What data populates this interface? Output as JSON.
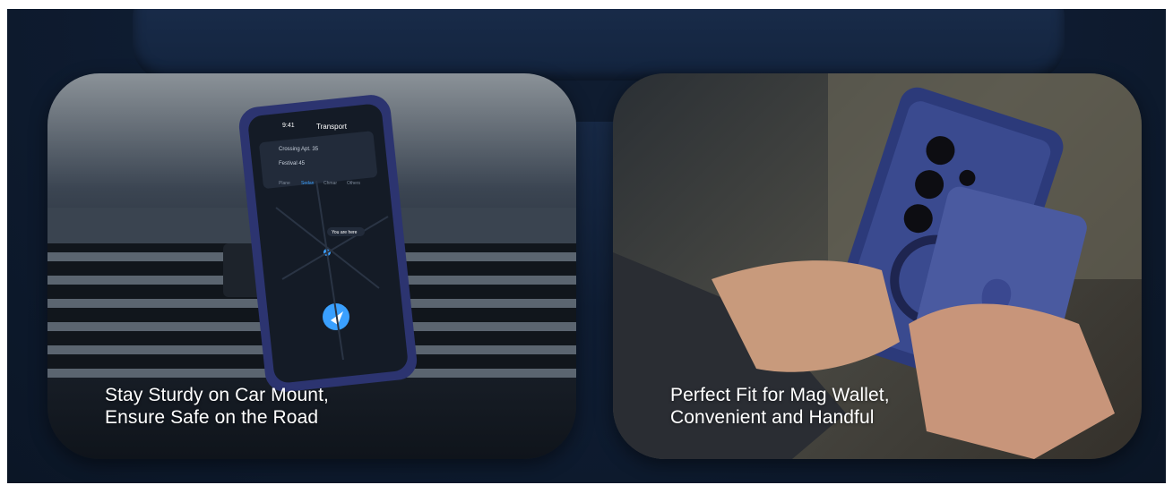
{
  "panels": [
    {
      "caption_line1": "Stay Sturdy on Car Mount,",
      "caption_line2": "Ensure Safe on the Road",
      "phone_screen": {
        "time": "9:41",
        "title": "Transport",
        "from": "Crossing Apt. 35",
        "to": "Festival 45",
        "modes": [
          "Plane",
          "Sedan",
          "Chmar",
          "Others"
        ],
        "pin_label": "You are here"
      }
    },
    {
      "caption_line1": "Perfect Fit for Mag Wallet,",
      "caption_line2": "Convenient and Handful"
    }
  ],
  "colors": {
    "banner_bg": "#0f1d33",
    "case_blue": "#2c3a7a",
    "accent_blue": "#3aa0ff"
  }
}
